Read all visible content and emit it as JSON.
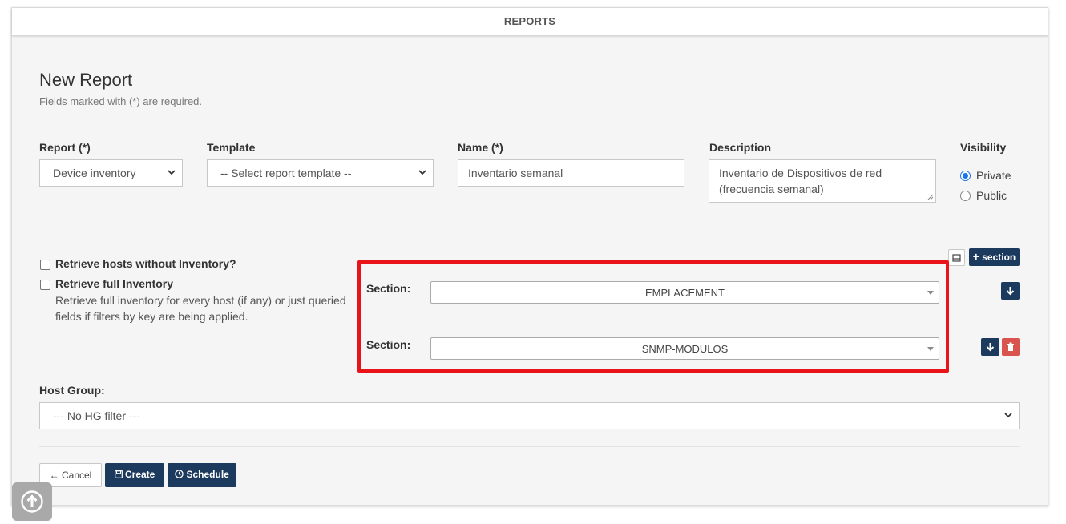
{
  "header": {
    "title": "REPORTS"
  },
  "form": {
    "title": "New Report",
    "subtitle": "Fields marked with (*) are required.",
    "report": {
      "label": "Report (*)",
      "value": "Device inventory"
    },
    "template": {
      "label": "Template",
      "value": "-- Select report template --"
    },
    "name": {
      "label": "Name (*)",
      "value": "Inventario semanal"
    },
    "description": {
      "label": "Description",
      "value": "Inventario de Dispositivos de red (frecuencia semanal)"
    },
    "visibility": {
      "label": "Visibility",
      "options": [
        "Private",
        "Public"
      ],
      "selected": "Private"
    },
    "options": {
      "retrieve_hosts": {
        "label": "Retrieve hosts without Inventory?",
        "checked": false
      },
      "retrieve_full": {
        "label": "Retrieve full Inventory",
        "checked": false,
        "help": "Retrieve full inventory for every host (if any) or just queried fields if filters by key are being applied."
      }
    },
    "sections": {
      "add_label": "section",
      "items": [
        {
          "label": "Section:",
          "value": "EMPLACEMENT"
        },
        {
          "label": "Section:",
          "value": "SNMP-MODULOS"
        }
      ]
    },
    "host_group": {
      "label": "Host Group:",
      "value": "--- No HG filter ---"
    },
    "buttons": {
      "cancel": "Cancel",
      "create": "Create",
      "schedule": "Schedule"
    }
  },
  "colors": {
    "primary": "#1c3a5e",
    "danger": "#d9534f",
    "highlight": "#e8141a"
  }
}
